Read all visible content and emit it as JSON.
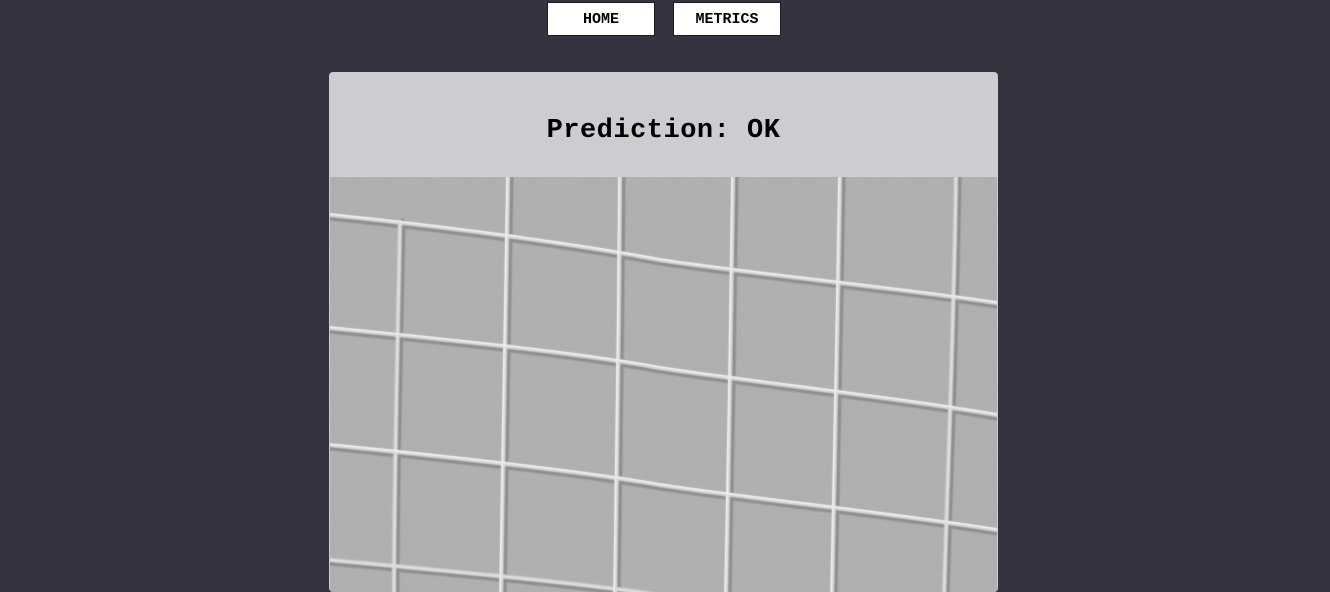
{
  "nav": {
    "home_label": "HOME",
    "metrics_label": "METRICS"
  },
  "result": {
    "prediction_text": "Prediction: OK"
  },
  "colors": {
    "background": "#34333f",
    "card": "#cdccd1",
    "button": "#ffffff"
  },
  "image": {
    "description": "grayscale surface texture"
  }
}
